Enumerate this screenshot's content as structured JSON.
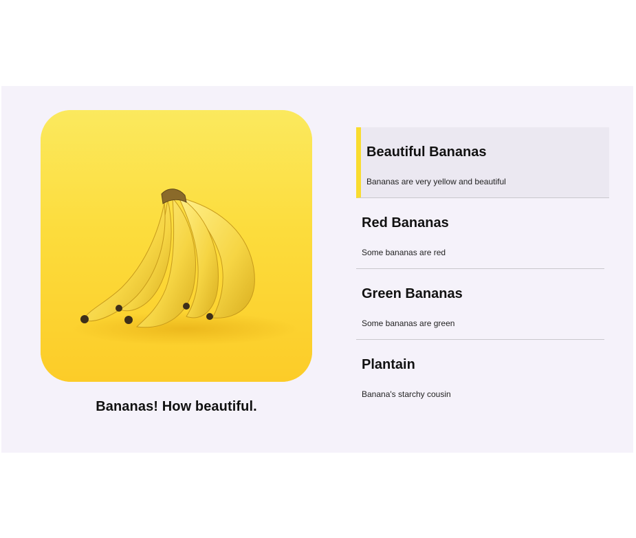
{
  "gallery": {
    "caption": "Bananas! How beautiful.",
    "image_subject": "bunch-of-bananas-on-yellow-background"
  },
  "colors": {
    "panel_background": "#f5f2fa",
    "active_background": "#ebe8f1",
    "accent": "#f9dc2f"
  },
  "items": [
    {
      "title": "Beautiful Bananas",
      "description": "Bananas are very yellow and beautiful",
      "active": true
    },
    {
      "title": "Red Bananas",
      "description": "Some bananas are red",
      "active": false
    },
    {
      "title": "Green Bananas",
      "description": "Some bananas are green",
      "active": false
    },
    {
      "title": "Plantain",
      "description": "Banana's starchy cousin",
      "active": false
    }
  ]
}
